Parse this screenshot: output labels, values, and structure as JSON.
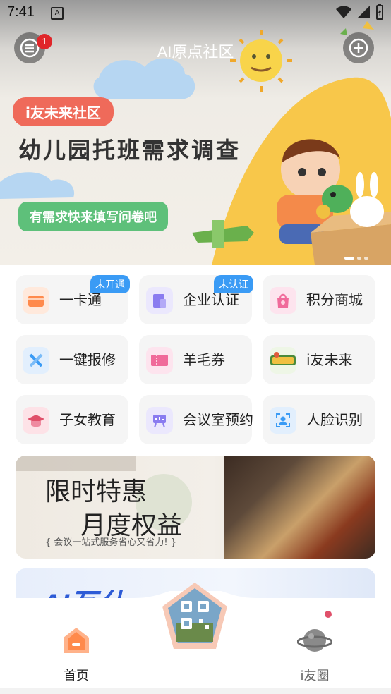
{
  "status": {
    "time": "7:41",
    "notif_icon": "A"
  },
  "header": {
    "title": "AI原点社区",
    "badge_count": "1"
  },
  "banner": {
    "tag": "i友未来社区",
    "headline": "幼儿园托班需求调查",
    "cta": "有需求快来填写问卷吧"
  },
  "grid": [
    {
      "label": "一卡通",
      "corner": "未开通",
      "icon": "card-icon",
      "color": "#ff8a4c"
    },
    {
      "label": "企业认证",
      "corner": "未认证",
      "icon": "enterprise-icon",
      "color": "#8a7cf0"
    },
    {
      "label": "积分商城",
      "corner": "",
      "icon": "shop-bag-icon",
      "color": "#f06a9a"
    },
    {
      "label": "一键报修",
      "corner": "",
      "icon": "repair-icon",
      "color": "#3a9bf5"
    },
    {
      "label": "羊毛券",
      "corner": "",
      "icon": "coupon-icon",
      "color": "#f06a9a"
    },
    {
      "label": "i友未来",
      "corner": "",
      "icon": "aijia-logo-icon",
      "color": "#4a8a3a"
    },
    {
      "label": "子女教育",
      "corner": "",
      "icon": "graduation-cap-icon",
      "color": "#e0506a"
    },
    {
      "label": "会议室预约",
      "corner": "",
      "icon": "meeting-board-icon",
      "color": "#8a7cf0"
    },
    {
      "label": "人脸识别",
      "corner": "",
      "icon": "face-scan-icon",
      "color": "#3a9bf5"
    }
  ],
  "promo": {
    "line1": "限时特惠",
    "line2": "月度权益",
    "line3": "{ 会议一站式服务省心又省力! }"
  },
  "promo2": {
    "text": "AI互仕"
  },
  "tabbar": {
    "home": "首页",
    "circle": "i友圈"
  },
  "colors": {
    "accent": "#ff8a4c",
    "corner_badge": "#3a9bf5",
    "notif_badge": "#e0262a"
  }
}
